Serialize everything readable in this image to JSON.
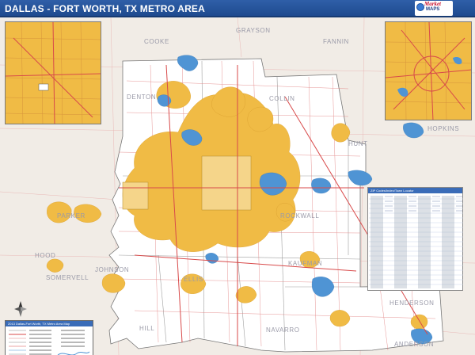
{
  "header": {
    "title": "DALLAS - FORT WORTH, TX METRO AREA",
    "logo_word_top": "Market",
    "logo_word_bottom": "MAPS"
  },
  "counties": [
    {
      "id": "cooke",
      "label": "COOKE"
    },
    {
      "id": "grayson",
      "label": "GRAYSON"
    },
    {
      "id": "fannin",
      "label": "FANNIN"
    },
    {
      "id": "denton",
      "label": "DENTON"
    },
    {
      "id": "collin",
      "label": "COLLIN"
    },
    {
      "id": "hopkins",
      "label": "HOPKINS"
    },
    {
      "id": "hunt",
      "label": "HUNT"
    },
    {
      "id": "parker",
      "label": "PARKER"
    },
    {
      "id": "hood",
      "label": "HOOD"
    },
    {
      "id": "johnson",
      "label": "JOHNSON"
    },
    {
      "id": "somervell",
      "label": "SOMERVELL"
    },
    {
      "id": "ellis",
      "label": "ELLIS"
    },
    {
      "id": "kaufman",
      "label": "KAUFMAN"
    },
    {
      "id": "rockwall",
      "label": "ROCKWALL"
    },
    {
      "id": "henderson",
      "label": "HENDERSON"
    },
    {
      "id": "hill",
      "label": "HILL"
    },
    {
      "id": "navarro",
      "label": "NAVARRO"
    },
    {
      "id": "anderson",
      "label": "ANDERSON"
    }
  ],
  "index_table": {
    "title": "ZIP Codes/Index/Town Locator"
  },
  "legend": {
    "title": "2013 Dallas-Fort Worth, TX Metro Area Map"
  },
  "colors": {
    "header_bg": "#1e4a8f",
    "urban": "#f0bb45",
    "water": "#4f94d4",
    "outside": "#f1ece6",
    "inside": "#ffffff",
    "highway": "#d84a4a"
  }
}
